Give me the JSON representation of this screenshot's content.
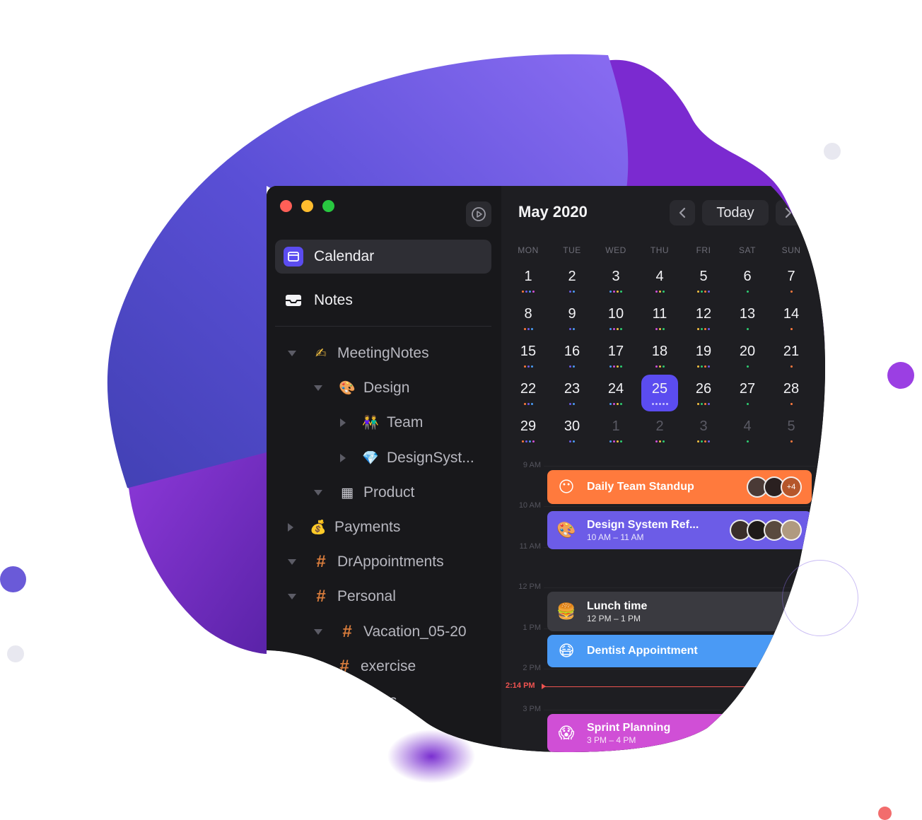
{
  "window": {
    "traffic_lights": [
      "#ff5f57",
      "#febc2e",
      "#28c840"
    ]
  },
  "sidebar": {
    "nav": [
      {
        "label": "Calendar",
        "icon": "calendar-icon",
        "active": true
      },
      {
        "label": "Notes",
        "icon": "inbox-icon",
        "active": false
      }
    ],
    "tree": [
      {
        "label": "MeetingNotes",
        "icon": "writing-hand",
        "glyph": "✍",
        "expanded": true
      },
      {
        "label": "Design",
        "icon": "palette",
        "glyph": "🎨",
        "expanded": true
      },
      {
        "label": "Team",
        "icon": "people",
        "glyph": "👫",
        "expanded": false
      },
      {
        "label": "DesignSyst...",
        "icon": "gem",
        "glyph": "💎",
        "expanded": false
      },
      {
        "label": "Product",
        "icon": "grid-box",
        "glyph": "▦",
        "expanded": true
      },
      {
        "label": "Payments",
        "icon": "money-bag",
        "glyph": "💰",
        "expanded": false
      },
      {
        "label": "DrAppointments",
        "icon": "hash",
        "glyph": "#",
        "expanded": true
      },
      {
        "label": "Personal",
        "icon": "hash",
        "glyph": "#",
        "expanded": true
      },
      {
        "label": "Vacation_05-20",
        "icon": "hash",
        "glyph": "#",
        "expanded": true
      },
      {
        "label": "exercise",
        "icon": "hash",
        "glyph": "#",
        "expanded": false
      },
      {
        "label": "Ideas",
        "icon": "hash",
        "glyph": "#",
        "expanded": false
      }
    ]
  },
  "calendar": {
    "month_title": "May 2020",
    "today_label": "Today",
    "weekdays": [
      "MON",
      "TUE",
      "WED",
      "THU",
      "FRI",
      "SAT",
      "SUN"
    ],
    "weeks": [
      [
        "1",
        "2",
        "3",
        "4",
        "5",
        "6",
        "7"
      ],
      [
        "8",
        "9",
        "10",
        "11",
        "12",
        "13",
        "14"
      ],
      [
        "15",
        "16",
        "17",
        "18",
        "19",
        "20",
        "21"
      ],
      [
        "22",
        "23",
        "24",
        "25",
        "26",
        "27",
        "28"
      ],
      [
        "29",
        "30",
        "1",
        "2",
        "3",
        "4",
        "5"
      ]
    ],
    "today_day": "25",
    "hours": [
      "9 AM",
      "10 AM",
      "11 AM",
      "12 PM",
      "1 PM",
      "2 PM",
      "3 PM"
    ],
    "now_label": "2:14 PM",
    "colors": {
      "accent": "#5b4cf0",
      "orange": "#ff7a3d",
      "purple": "#6c5ce7",
      "gray": "#3a3a40",
      "blue": "#4a9af5",
      "pink": "#d04fd6",
      "now": "#ef5350"
    }
  },
  "events": [
    {
      "title": "Daily Team Standup",
      "time": "",
      "emoji": "😶",
      "color": "#ff7a3d",
      "extra_attendees": "+4"
    },
    {
      "title": "Design System Ref...",
      "time": "10 AM – 11 AM",
      "emoji": "🎨",
      "color": "#6c5ce7",
      "extra_attendees": ""
    },
    {
      "title": "Lunch time",
      "time": "12 PM – 1 PM",
      "emoji": "🍔",
      "color": "#3a3a40",
      "extra_attendees": ""
    },
    {
      "title": "Dentist Appointment",
      "time": "",
      "emoji": "😷",
      "color": "#4a9af5",
      "extra_attendees": ""
    },
    {
      "title": "Sprint Planning",
      "time": "3 PM – 4 PM",
      "emoji": "😱",
      "color": "#d04fd6",
      "extra_attendees": ""
    }
  ]
}
